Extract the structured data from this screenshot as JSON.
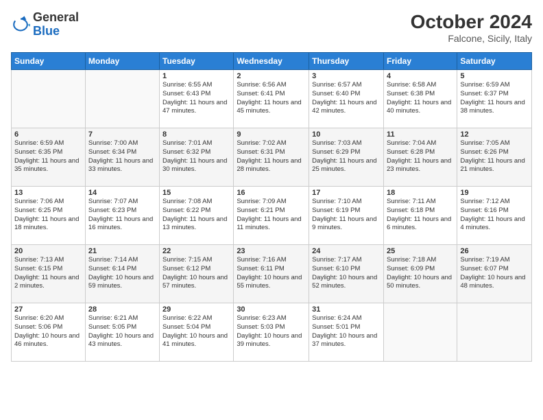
{
  "header": {
    "logo_general": "General",
    "logo_blue": "Blue",
    "month_year": "October 2024",
    "location": "Falcone, Sicily, Italy"
  },
  "days_of_week": [
    "Sunday",
    "Monday",
    "Tuesday",
    "Wednesday",
    "Thursday",
    "Friday",
    "Saturday"
  ],
  "weeks": [
    [
      {
        "day": "",
        "info": ""
      },
      {
        "day": "",
        "info": ""
      },
      {
        "day": "1",
        "info": "Sunrise: 6:55 AM\nSunset: 6:43 PM\nDaylight: 11 hours and 47 minutes."
      },
      {
        "day": "2",
        "info": "Sunrise: 6:56 AM\nSunset: 6:41 PM\nDaylight: 11 hours and 45 minutes."
      },
      {
        "day": "3",
        "info": "Sunrise: 6:57 AM\nSunset: 6:40 PM\nDaylight: 11 hours and 42 minutes."
      },
      {
        "day": "4",
        "info": "Sunrise: 6:58 AM\nSunset: 6:38 PM\nDaylight: 11 hours and 40 minutes."
      },
      {
        "day": "5",
        "info": "Sunrise: 6:59 AM\nSunset: 6:37 PM\nDaylight: 11 hours and 38 minutes."
      }
    ],
    [
      {
        "day": "6",
        "info": "Sunrise: 6:59 AM\nSunset: 6:35 PM\nDaylight: 11 hours and 35 minutes."
      },
      {
        "day": "7",
        "info": "Sunrise: 7:00 AM\nSunset: 6:34 PM\nDaylight: 11 hours and 33 minutes."
      },
      {
        "day": "8",
        "info": "Sunrise: 7:01 AM\nSunset: 6:32 PM\nDaylight: 11 hours and 30 minutes."
      },
      {
        "day": "9",
        "info": "Sunrise: 7:02 AM\nSunset: 6:31 PM\nDaylight: 11 hours and 28 minutes."
      },
      {
        "day": "10",
        "info": "Sunrise: 7:03 AM\nSunset: 6:29 PM\nDaylight: 11 hours and 25 minutes."
      },
      {
        "day": "11",
        "info": "Sunrise: 7:04 AM\nSunset: 6:28 PM\nDaylight: 11 hours and 23 minutes."
      },
      {
        "day": "12",
        "info": "Sunrise: 7:05 AM\nSunset: 6:26 PM\nDaylight: 11 hours and 21 minutes."
      }
    ],
    [
      {
        "day": "13",
        "info": "Sunrise: 7:06 AM\nSunset: 6:25 PM\nDaylight: 11 hours and 18 minutes."
      },
      {
        "day": "14",
        "info": "Sunrise: 7:07 AM\nSunset: 6:23 PM\nDaylight: 11 hours and 16 minutes."
      },
      {
        "day": "15",
        "info": "Sunrise: 7:08 AM\nSunset: 6:22 PM\nDaylight: 11 hours and 13 minutes."
      },
      {
        "day": "16",
        "info": "Sunrise: 7:09 AM\nSunset: 6:21 PM\nDaylight: 11 hours and 11 minutes."
      },
      {
        "day": "17",
        "info": "Sunrise: 7:10 AM\nSunset: 6:19 PM\nDaylight: 11 hours and 9 minutes."
      },
      {
        "day": "18",
        "info": "Sunrise: 7:11 AM\nSunset: 6:18 PM\nDaylight: 11 hours and 6 minutes."
      },
      {
        "day": "19",
        "info": "Sunrise: 7:12 AM\nSunset: 6:16 PM\nDaylight: 11 hours and 4 minutes."
      }
    ],
    [
      {
        "day": "20",
        "info": "Sunrise: 7:13 AM\nSunset: 6:15 PM\nDaylight: 11 hours and 2 minutes."
      },
      {
        "day": "21",
        "info": "Sunrise: 7:14 AM\nSunset: 6:14 PM\nDaylight: 10 hours and 59 minutes."
      },
      {
        "day": "22",
        "info": "Sunrise: 7:15 AM\nSunset: 6:12 PM\nDaylight: 10 hours and 57 minutes."
      },
      {
        "day": "23",
        "info": "Sunrise: 7:16 AM\nSunset: 6:11 PM\nDaylight: 10 hours and 55 minutes."
      },
      {
        "day": "24",
        "info": "Sunrise: 7:17 AM\nSunset: 6:10 PM\nDaylight: 10 hours and 52 minutes."
      },
      {
        "day": "25",
        "info": "Sunrise: 7:18 AM\nSunset: 6:09 PM\nDaylight: 10 hours and 50 minutes."
      },
      {
        "day": "26",
        "info": "Sunrise: 7:19 AM\nSunset: 6:07 PM\nDaylight: 10 hours and 48 minutes."
      }
    ],
    [
      {
        "day": "27",
        "info": "Sunrise: 6:20 AM\nSunset: 5:06 PM\nDaylight: 10 hours and 46 minutes."
      },
      {
        "day": "28",
        "info": "Sunrise: 6:21 AM\nSunset: 5:05 PM\nDaylight: 10 hours and 43 minutes."
      },
      {
        "day": "29",
        "info": "Sunrise: 6:22 AM\nSunset: 5:04 PM\nDaylight: 10 hours and 41 minutes."
      },
      {
        "day": "30",
        "info": "Sunrise: 6:23 AM\nSunset: 5:03 PM\nDaylight: 10 hours and 39 minutes."
      },
      {
        "day": "31",
        "info": "Sunrise: 6:24 AM\nSunset: 5:01 PM\nDaylight: 10 hours and 37 minutes."
      },
      {
        "day": "",
        "info": ""
      },
      {
        "day": "",
        "info": ""
      }
    ]
  ]
}
